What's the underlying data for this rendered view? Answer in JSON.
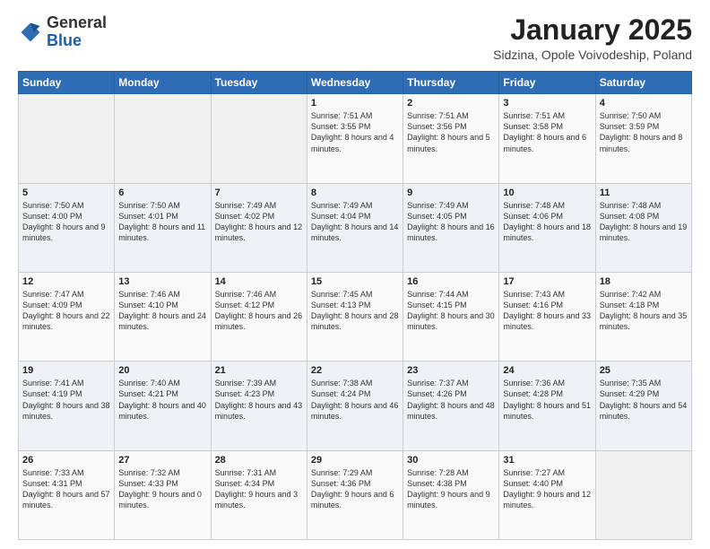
{
  "header": {
    "logo_general": "General",
    "logo_blue": "Blue",
    "month": "January 2025",
    "location": "Sidzina, Opole Voivodeship, Poland"
  },
  "days_of_week": [
    "Sunday",
    "Monday",
    "Tuesday",
    "Wednesday",
    "Thursday",
    "Friday",
    "Saturday"
  ],
  "weeks": [
    [
      {
        "day": "",
        "content": ""
      },
      {
        "day": "",
        "content": ""
      },
      {
        "day": "",
        "content": ""
      },
      {
        "day": "1",
        "content": "Sunrise: 7:51 AM\nSunset: 3:55 PM\nDaylight: 8 hours\nand 4 minutes."
      },
      {
        "day": "2",
        "content": "Sunrise: 7:51 AM\nSunset: 3:56 PM\nDaylight: 8 hours\nand 5 minutes."
      },
      {
        "day": "3",
        "content": "Sunrise: 7:51 AM\nSunset: 3:58 PM\nDaylight: 8 hours\nand 6 minutes."
      },
      {
        "day": "4",
        "content": "Sunrise: 7:50 AM\nSunset: 3:59 PM\nDaylight: 8 hours\nand 8 minutes."
      }
    ],
    [
      {
        "day": "5",
        "content": "Sunrise: 7:50 AM\nSunset: 4:00 PM\nDaylight: 8 hours\nand 9 minutes."
      },
      {
        "day": "6",
        "content": "Sunrise: 7:50 AM\nSunset: 4:01 PM\nDaylight: 8 hours\nand 11 minutes."
      },
      {
        "day": "7",
        "content": "Sunrise: 7:49 AM\nSunset: 4:02 PM\nDaylight: 8 hours\nand 12 minutes."
      },
      {
        "day": "8",
        "content": "Sunrise: 7:49 AM\nSunset: 4:04 PM\nDaylight: 8 hours\nand 14 minutes."
      },
      {
        "day": "9",
        "content": "Sunrise: 7:49 AM\nSunset: 4:05 PM\nDaylight: 8 hours\nand 16 minutes."
      },
      {
        "day": "10",
        "content": "Sunrise: 7:48 AM\nSunset: 4:06 PM\nDaylight: 8 hours\nand 18 minutes."
      },
      {
        "day": "11",
        "content": "Sunrise: 7:48 AM\nSunset: 4:08 PM\nDaylight: 8 hours\nand 19 minutes."
      }
    ],
    [
      {
        "day": "12",
        "content": "Sunrise: 7:47 AM\nSunset: 4:09 PM\nDaylight: 8 hours\nand 22 minutes."
      },
      {
        "day": "13",
        "content": "Sunrise: 7:46 AM\nSunset: 4:10 PM\nDaylight: 8 hours\nand 24 minutes."
      },
      {
        "day": "14",
        "content": "Sunrise: 7:46 AM\nSunset: 4:12 PM\nDaylight: 8 hours\nand 26 minutes."
      },
      {
        "day": "15",
        "content": "Sunrise: 7:45 AM\nSunset: 4:13 PM\nDaylight: 8 hours\nand 28 minutes."
      },
      {
        "day": "16",
        "content": "Sunrise: 7:44 AM\nSunset: 4:15 PM\nDaylight: 8 hours\nand 30 minutes."
      },
      {
        "day": "17",
        "content": "Sunrise: 7:43 AM\nSunset: 4:16 PM\nDaylight: 8 hours\nand 33 minutes."
      },
      {
        "day": "18",
        "content": "Sunrise: 7:42 AM\nSunset: 4:18 PM\nDaylight: 8 hours\nand 35 minutes."
      }
    ],
    [
      {
        "day": "19",
        "content": "Sunrise: 7:41 AM\nSunset: 4:19 PM\nDaylight: 8 hours\nand 38 minutes."
      },
      {
        "day": "20",
        "content": "Sunrise: 7:40 AM\nSunset: 4:21 PM\nDaylight: 8 hours\nand 40 minutes."
      },
      {
        "day": "21",
        "content": "Sunrise: 7:39 AM\nSunset: 4:23 PM\nDaylight: 8 hours\nand 43 minutes."
      },
      {
        "day": "22",
        "content": "Sunrise: 7:38 AM\nSunset: 4:24 PM\nDaylight: 8 hours\nand 46 minutes."
      },
      {
        "day": "23",
        "content": "Sunrise: 7:37 AM\nSunset: 4:26 PM\nDaylight: 8 hours\nand 48 minutes."
      },
      {
        "day": "24",
        "content": "Sunrise: 7:36 AM\nSunset: 4:28 PM\nDaylight: 8 hours\nand 51 minutes."
      },
      {
        "day": "25",
        "content": "Sunrise: 7:35 AM\nSunset: 4:29 PM\nDaylight: 8 hours\nand 54 minutes."
      }
    ],
    [
      {
        "day": "26",
        "content": "Sunrise: 7:33 AM\nSunset: 4:31 PM\nDaylight: 8 hours\nand 57 minutes."
      },
      {
        "day": "27",
        "content": "Sunrise: 7:32 AM\nSunset: 4:33 PM\nDaylight: 9 hours\nand 0 minutes."
      },
      {
        "day": "28",
        "content": "Sunrise: 7:31 AM\nSunset: 4:34 PM\nDaylight: 9 hours\nand 3 minutes."
      },
      {
        "day": "29",
        "content": "Sunrise: 7:29 AM\nSunset: 4:36 PM\nDaylight: 9 hours\nand 6 minutes."
      },
      {
        "day": "30",
        "content": "Sunrise: 7:28 AM\nSunset: 4:38 PM\nDaylight: 9 hours\nand 9 minutes."
      },
      {
        "day": "31",
        "content": "Sunrise: 7:27 AM\nSunset: 4:40 PM\nDaylight: 9 hours\nand 12 minutes."
      },
      {
        "day": "",
        "content": ""
      }
    ]
  ]
}
